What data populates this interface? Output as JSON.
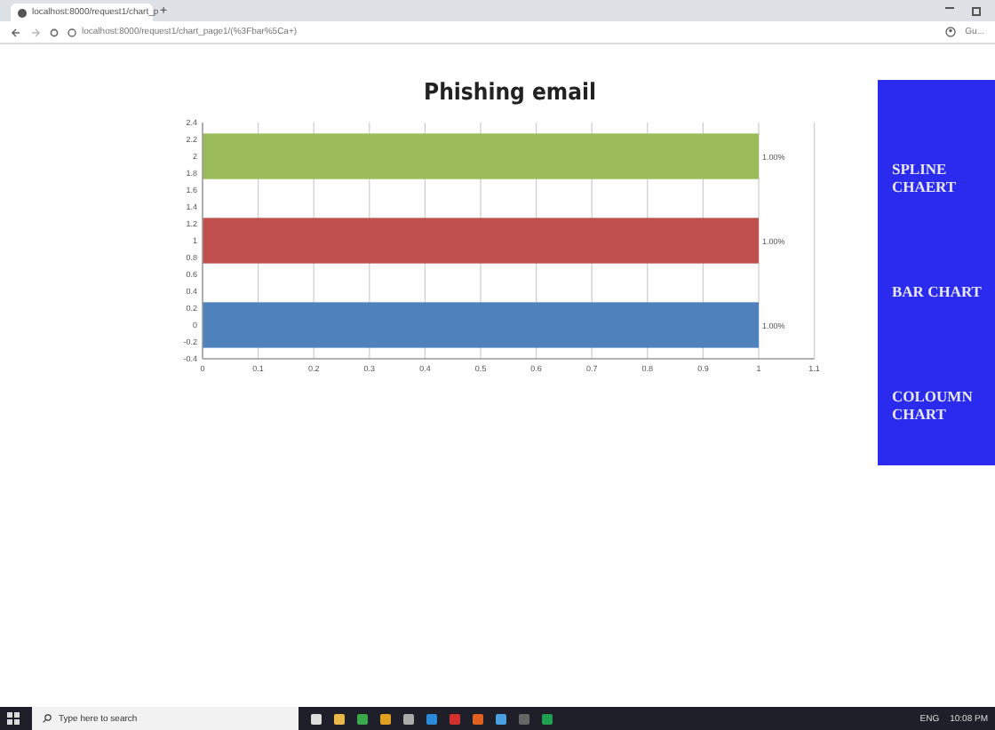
{
  "browser": {
    "tab_title": "localhost:8000/request1/chart_p",
    "new_tab": "+",
    "address": "localhost:8000/request1/chart_page1/(%3Fbar%5Ca+)",
    "profile": "Gu..."
  },
  "chart": {
    "chart_data": {
      "type": "bar",
      "orientation": "horizontal",
      "title": "Phishing email",
      "x": [
        0,
        1,
        2
      ],
      "values": [
        1,
        1,
        1
      ],
      "colors": [
        "#4f81bc",
        "#c0504e",
        "#9bbb58"
      ],
      "value_labels": [
        "1.00%",
        "1.00%",
        "1.00%"
      ],
      "grid": true,
      "xlim": [
        0,
        1.1
      ],
      "ylim": [
        -0.4,
        2.4
      ],
      "xticks": [
        0,
        0.1,
        0.2,
        0.3,
        0.4,
        0.5,
        0.6,
        0.7,
        0.8,
        0.9,
        1,
        1.1
      ],
      "yticks": [
        -0.4,
        -0.2,
        0,
        0.2,
        0.4,
        0.6,
        0.8,
        1,
        1.2,
        1.4,
        1.6,
        1.8,
        2,
        2.2,
        2.4
      ]
    }
  },
  "side_menu": [
    {
      "label": "SPLINE CHAERT"
    },
    {
      "label": "BAR CHART"
    },
    {
      "label": "COLOUMN CHART"
    }
  ],
  "taskbar": {
    "search_placeholder": "Type here to search",
    "language": "ENG",
    "time": "10:08 PM"
  }
}
